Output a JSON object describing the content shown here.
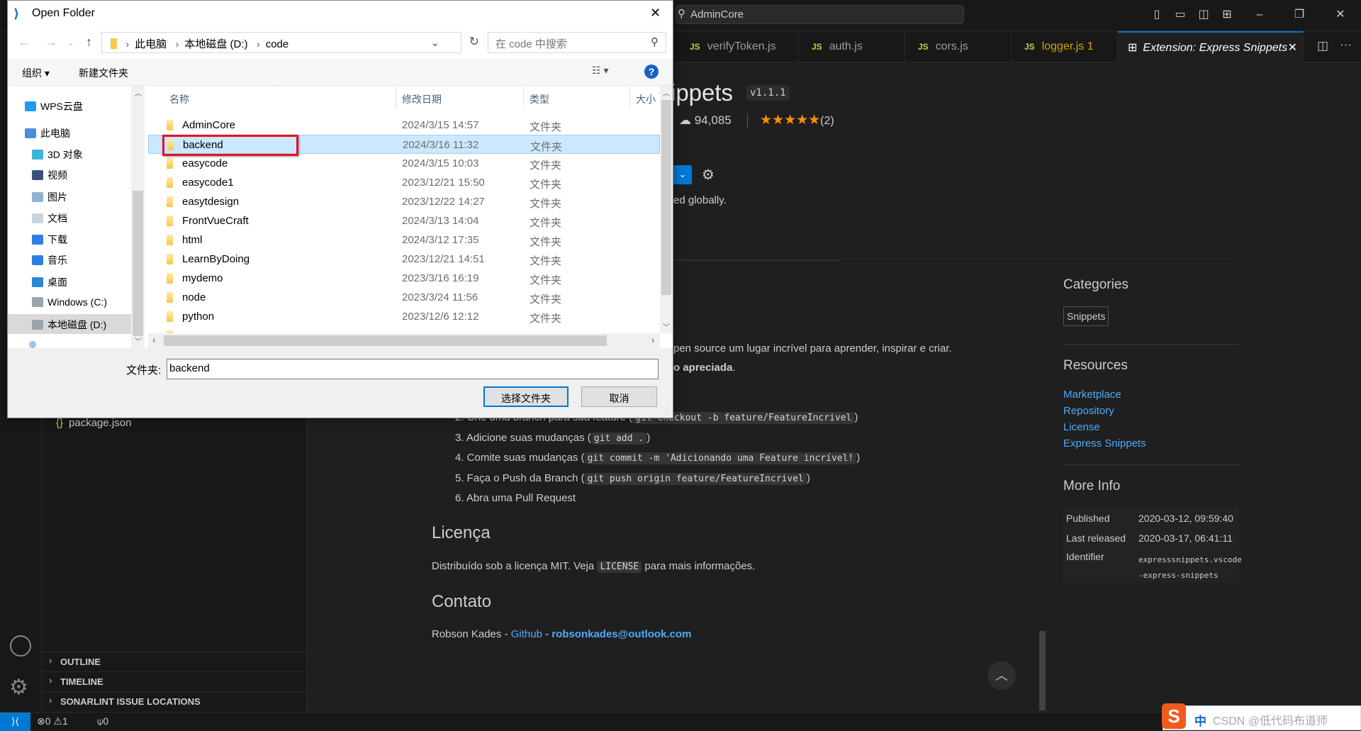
{
  "titlebar": {
    "search_text": "AdminCore",
    "icons": [
      "toggle-primary-sidebar",
      "toggle-panel",
      "toggle-secondary-sidebar",
      "customize-layout",
      "minimize",
      "maximize",
      "close"
    ]
  },
  "tabs": [
    {
      "label": "verifyToken.js",
      "icon": "JS"
    },
    {
      "label": "auth.js",
      "icon": "JS"
    },
    {
      "label": "cors.js",
      "icon": "JS"
    },
    {
      "label": "logger.js 1",
      "icon": "JS"
    },
    {
      "label": "Extension: Express Snippets",
      "icon": "extensions-icon",
      "active": true
    }
  ],
  "extension": {
    "title_fragment": "ippets",
    "version": "v1.1.1",
    "downloads": "94,085",
    "stars": 5,
    "rating_count": "(2)",
    "enabled_text_fragment": "ed globally.",
    "readme": {
      "intro_fragment": "pen source um lugar incrível para aprender, inspirar e criar.",
      "bold_fragment": "o apreciada",
      "steps": [
        {
          "text": "2. Crie uma branch para sua feature (",
          "code": "git checkout -b feature/FeatureIncrivel",
          "end": ")"
        },
        {
          "text": "3. Adicione suas mudanças (",
          "code": "git add .",
          "end": ")"
        },
        {
          "text": "4. Comite suas mudanças (",
          "code": "git commit -m 'Adicionando uma Feature incrível!",
          "end": ")"
        },
        {
          "text": "5. Faça o Push da Branch (",
          "code": "git push origin feature/FeatureIncrivel",
          "end": ")"
        },
        {
          "text": "6. Abra uma Pull Request"
        }
      ],
      "license_heading": "Licença",
      "license_pre": "Distribuído sob a licença MIT. Veja ",
      "license_code": "LICENSE",
      "license_post": " para mais informações.",
      "contact_heading": "Contato",
      "contact_name": "Robson Kades - ",
      "contact_github": "Github",
      "contact_sep": " - ",
      "contact_email": "robsonkades@outlook.com"
    },
    "sidebar": {
      "categories_heading": "Categories",
      "category": "Snippets",
      "resources_heading": "Resources",
      "resources": [
        "Marketplace",
        "Repository",
        "License",
        "Express Snippets"
      ],
      "more_info_heading": "More Info",
      "info": [
        {
          "label": "Published",
          "value": "2020-03-12, 09:59:40"
        },
        {
          "label": "Last released",
          "value": "2020-03-17, 06:41:11"
        },
        {
          "label": "Identifier",
          "value": "expresssnippets.vscode-express-snippets"
        }
      ]
    }
  },
  "explorer": {
    "file": "package.json",
    "panels": [
      "OUTLINE",
      "TIMELINE",
      "SONARLINT ISSUE LOCATIONS"
    ]
  },
  "statusbar": {
    "errors": "0",
    "warnings": "1",
    "ports": "0"
  },
  "dialog": {
    "title": "Open Folder",
    "breadcrumb": [
      "此电脑",
      "本地磁盘 (D:)",
      "code"
    ],
    "search_placeholder": "在 code 中搜索",
    "organize": "组织 ▾",
    "new_folder": "新建文件夹",
    "nav": [
      {
        "label": "WPS云盘",
        "color": "#1e9bf0"
      },
      {
        "label": "此电脑",
        "color": "#4a8fd8"
      },
      {
        "label": "3D 对象",
        "color": "#3bb4d8"
      },
      {
        "label": "视频",
        "color": "#3a4f7a"
      },
      {
        "label": "图片",
        "color": "#8fb3cf"
      },
      {
        "label": "文档",
        "color": "#c9d3de"
      },
      {
        "label": "下载",
        "color": "#2f7fe0"
      },
      {
        "label": "音乐",
        "color": "#2f7fe0"
      },
      {
        "label": "桌面",
        "color": "#2a8ad6"
      },
      {
        "label": "Windows (C:)",
        "color": "#9aa4ad"
      },
      {
        "label": "本地磁盘 (D:)",
        "color": "#9aa4ad",
        "selected": true
      }
    ],
    "columns": [
      "名称",
      "修改日期",
      "类型",
      "大小"
    ],
    "rows": [
      {
        "name": "AdminCore",
        "date": "2024/3/15 14:57",
        "type": "文件夹"
      },
      {
        "name": "backend",
        "date": "2024/3/16 11:32",
        "type": "文件夹",
        "selected": true
      },
      {
        "name": "easycode",
        "date": "2024/3/15 10:03",
        "type": "文件夹"
      },
      {
        "name": "easycode1",
        "date": "2023/12/21 15:50",
        "type": "文件夹"
      },
      {
        "name": "easytdesign",
        "date": "2023/12/22 14:27",
        "type": "文件夹"
      },
      {
        "name": "FrontVueCraft",
        "date": "2024/3/13 14:04",
        "type": "文件夹"
      },
      {
        "name": "html",
        "date": "2024/3/12 17:35",
        "type": "文件夹"
      },
      {
        "name": "LearnByDoing",
        "date": "2023/12/21 14:51",
        "type": "文件夹"
      },
      {
        "name": "mydemo",
        "date": "2023/3/16 16:19",
        "type": "文件夹"
      },
      {
        "name": "node",
        "date": "2023/3/24 11:56",
        "type": "文件夹"
      },
      {
        "name": "python",
        "date": "2023/12/6 12:12",
        "type": "文件夹"
      }
    ],
    "folder_label": "文件夹:",
    "folder_value": "backend",
    "select_button": "选择文件夹",
    "cancel_button": "取消",
    "highlight_color": "#e81123"
  },
  "ime": {
    "mode": "中",
    "watermark": "CSDN @低代码布道师"
  }
}
